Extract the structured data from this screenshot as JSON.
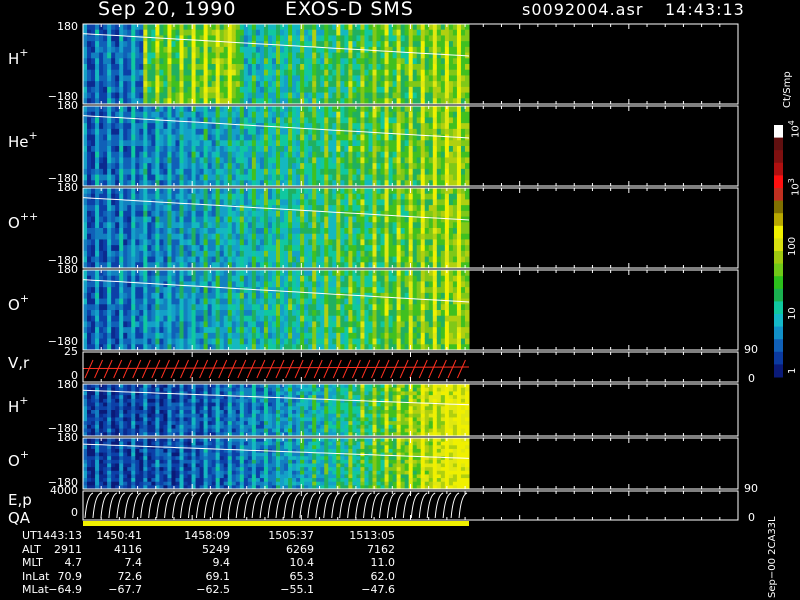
{
  "header": {
    "date": "Sep 20, 1990",
    "mission": "EXOS-D SMS",
    "file": "s0092004.asr",
    "time": "14:43:13"
  },
  "panels": [
    {
      "id": "h-plus-1",
      "ion": "H",
      "charge": "+",
      "top_tick": "180",
      "bottom_tick": "−180"
    },
    {
      "id": "he-plus",
      "ion": "He",
      "charge": "+",
      "top_tick": "180",
      "bottom_tick": "−180"
    },
    {
      "id": "o-plus-plus",
      "ion": "O",
      "charge": "++",
      "top_tick": "180",
      "bottom_tick": "−180"
    },
    {
      "id": "o-plus-1",
      "ion": "O",
      "charge": "+",
      "top_tick": "180",
      "bottom_tick": "−180"
    },
    {
      "id": "h-plus-2",
      "ion": "H",
      "charge": "+",
      "top_tick": "180",
      "bottom_tick": "−180"
    },
    {
      "id": "o-plus-2",
      "ion": "O",
      "charge": "+",
      "top_tick": "180",
      "bottom_tick": "−180"
    }
  ],
  "vr_panel": {
    "label": "V,r",
    "top_tick": "25",
    "bottom_tick": "0",
    "right_top": "90",
    "right_bottom": "0"
  },
  "ep_panel": {
    "label1": "E,p",
    "label2": "QA",
    "top_tick": "4000",
    "bottom_tick": "0",
    "right_top": "90",
    "right_bottom": "0"
  },
  "colorbar": {
    "unit": "Ct/Smp",
    "labels": [
      "1",
      "10",
      "100",
      "10",
      "10"
    ],
    "label_exps": [
      "",
      "",
      "",
      "3",
      "4"
    ],
    "colors": [
      "#0a1a78",
      "#0b3aa0",
      "#1060b8",
      "#1290c8",
      "#14b8c8",
      "#10c8a0",
      "#1ab050",
      "#2cc01c",
      "#70c818",
      "#a0c810",
      "#d8e010",
      "#f0f000",
      "#b8a800",
      "#807000",
      "#c03020",
      "#ff1010",
      "#b01010",
      "#801010",
      "#601010",
      "#ffffff"
    ],
    "gaps": [
      "#000000"
    ]
  },
  "ephemeris": {
    "labels": [
      "UT",
      "ALT",
      "MLT",
      "InLat",
      "MLat"
    ],
    "columns": [
      [
        "1443:13",
        "2911",
        "4.7",
        "70.9",
        "−64.9"
      ],
      [
        "1450:41",
        "4116",
        "7.4",
        "72.6",
        "−67.7"
      ],
      [
        "1458:09",
        "5249",
        "9.4",
        "69.1",
        "−62.5"
      ],
      [
        "1505:37",
        "6269",
        "10.4",
        "65.3",
        "−55.1"
      ],
      [
        "1513:05",
        "7162",
        "11.0",
        "62.0",
        "−47.6"
      ]
    ]
  },
  "footer": {
    "stamp": "Sep−00 2CA33L"
  },
  "chart_data": {
    "type": "heatmap",
    "x": [
      "1443:13",
      "1450:41",
      "1458:09",
      "1505:37",
      "1513:05"
    ],
    "panels": [
      "H+",
      "He+",
      "O++",
      "O+",
      "V,r",
      "H+",
      "O+",
      "E,p"
    ],
    "ylim": [
      -180,
      180
    ],
    "colorbar_scale": "log",
    "colorbar_range": [
      1,
      10000
    ]
  }
}
